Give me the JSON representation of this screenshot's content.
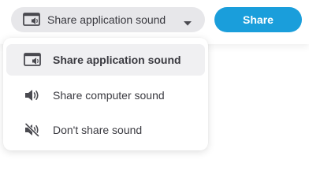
{
  "sound_selector": {
    "label": "Share application sound",
    "icon": "app-window-sound-icon"
  },
  "share_button": {
    "label": "Share"
  },
  "dropdown": {
    "items": [
      {
        "label": "Share application sound",
        "icon": "app-window-sound-icon",
        "selected": true
      },
      {
        "label": "Share computer sound",
        "icon": "speaker-icon",
        "selected": false
      },
      {
        "label": "Don't share sound",
        "icon": "speaker-muted-icon",
        "selected": false
      }
    ]
  },
  "colors": {
    "accent": "#1a9edb",
    "selector_background": "#e7e7ea",
    "selected_item_background": "#f0f0f2",
    "text": "#3a3a40",
    "icon": "#4a4a50"
  }
}
